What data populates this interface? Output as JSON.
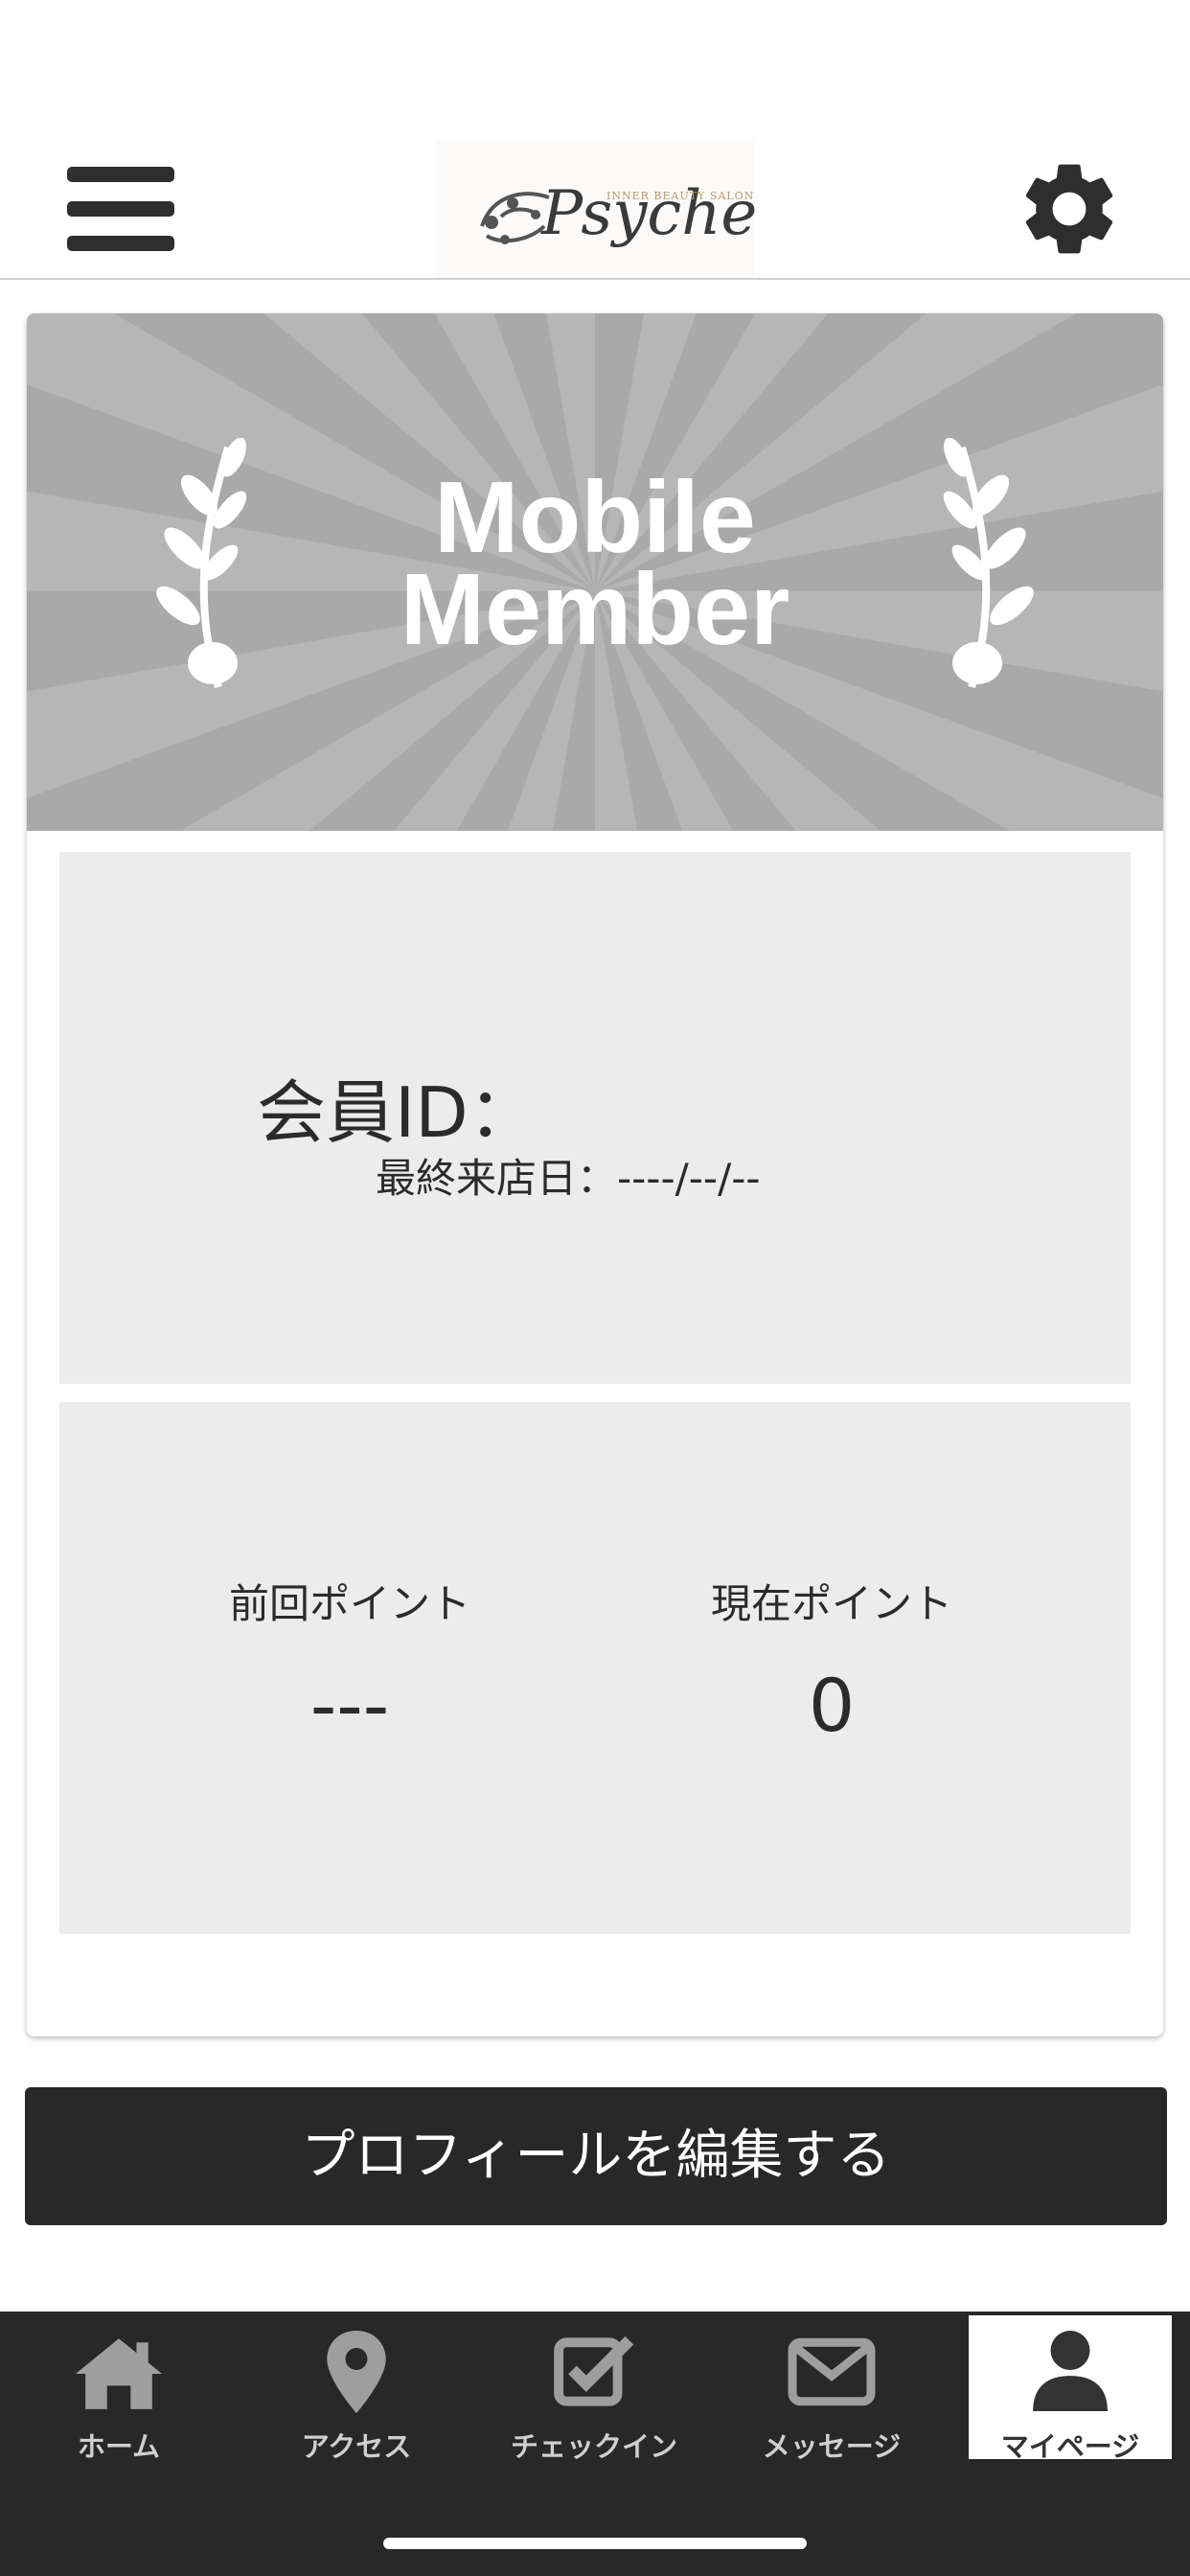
{
  "header": {
    "logo_text": "Psyche",
    "logo_tagline": "INNER BEAUTY SALON"
  },
  "card": {
    "banner_title_line1": "Mobile",
    "banner_title_line2": "Member",
    "member_id_label": "会員ID：",
    "last_visit": "最終来店日：----/--/--",
    "prev_points_label": "前回ポイント",
    "prev_points_value": "---",
    "current_points_label": "現在ポイント",
    "current_points_value": "0"
  },
  "edit_profile_label": "プロフィールを編集する",
  "tabs": [
    {
      "label": "ホーム",
      "icon": "home-icon"
    },
    {
      "label": "アクセス",
      "icon": "map-pin-icon"
    },
    {
      "label": "チェックイン",
      "icon": "checkbox-icon"
    },
    {
      "label": "メッセージ",
      "icon": "envelope-icon"
    },
    {
      "label": "マイページ",
      "icon": "user-icon",
      "active": true
    }
  ],
  "colors": {
    "banner_gray": "#a9a9a9",
    "panel_gray": "#ececec",
    "dark": "#282828"
  }
}
